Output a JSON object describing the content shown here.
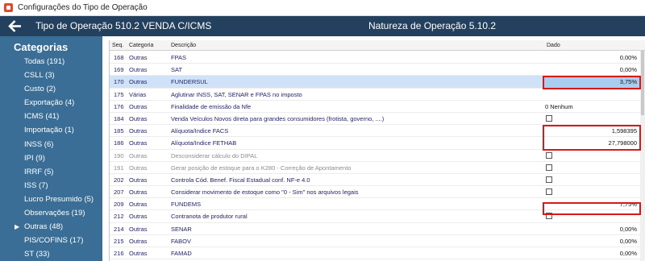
{
  "window": {
    "title": "Configurações do Tipo de Operação"
  },
  "header": {
    "operation_label": "Tipo de Operação 510.2   VENDA C/ICMS",
    "nature_label": "Natureza de Operação 5.10.2"
  },
  "sidebar": {
    "title": "Categorias",
    "items": [
      {
        "label": "Todas (191)"
      },
      {
        "label": "CSLL (3)"
      },
      {
        "label": "Custo (2)"
      },
      {
        "label": "Exportação (4)"
      },
      {
        "label": "ICMS (41)"
      },
      {
        "label": "Importação (1)"
      },
      {
        "label": "INSS (6)"
      },
      {
        "label": "IPI (9)"
      },
      {
        "label": "IRRF (5)"
      },
      {
        "label": "ISS (7)"
      },
      {
        "label": "Lucro Presumido (5)"
      },
      {
        "label": "Observações (19)"
      },
      {
        "label": "Outras (48)",
        "selected": true
      },
      {
        "label": "PIS/COFINS (17)"
      },
      {
        "label": "ST (33)"
      }
    ]
  },
  "grid": {
    "columns": {
      "seq": "Seq.",
      "categoria": "Categoria",
      "descricao": "Descrição",
      "dado": "Dado"
    },
    "rows": [
      {
        "seq": "168",
        "cat": "Outras",
        "desc": "FPAS",
        "type": "value",
        "value": "0,00%"
      },
      {
        "seq": "169",
        "cat": "Outras",
        "desc": "SAT",
        "type": "value",
        "value": "0,00%"
      },
      {
        "seq": "170",
        "cat": "Outras",
        "desc": "FUNDERSUL",
        "type": "value",
        "value": "3,75%",
        "selected": true
      },
      {
        "seq": "175",
        "cat": "Várias",
        "desc": "Aglutinar INSS, SAT, SENAR e FPAS no imposto",
        "type": "none"
      },
      {
        "seq": "176",
        "cat": "Outras",
        "desc": "Finalidade de emissão da Nfe",
        "type": "text",
        "value": "0  Nenhum"
      },
      {
        "seq": "184",
        "cat": "Outras",
        "desc": "Venda Veículos Novos direta para grandes consumidores (frotista, governo, ....)",
        "type": "check"
      },
      {
        "seq": "185",
        "cat": "Outras",
        "desc": "Alíquota/Indice FACS",
        "type": "value",
        "value": "1,598395"
      },
      {
        "seq": "186",
        "cat": "Outras",
        "desc": "Alíquota/Indice FETHAB",
        "type": "value",
        "value": "27,798000"
      },
      {
        "seq": "190",
        "cat": "Outras",
        "desc": "Desconsiderar cálculo do DIPAL",
        "type": "check",
        "disabled": true
      },
      {
        "seq": "191",
        "cat": "Outras",
        "desc": "Gerar posição de estoque para o K280 - Correção de Apontamento",
        "type": "check",
        "disabled": true
      },
      {
        "seq": "202",
        "cat": "Outras",
        "desc": "Controla Cód. Benef. Fiscal Estadual conf. NF-e 4.0",
        "type": "check"
      },
      {
        "seq": "207",
        "cat": "Outras",
        "desc": "Considerar movimento de estoque como \"0 - Sim\" nos arquivos legais",
        "type": "check"
      },
      {
        "seq": "209",
        "cat": "Outras",
        "desc": "FUNDEMS",
        "type": "value",
        "value": "7,75%"
      },
      {
        "seq": "212",
        "cat": "Outras",
        "desc": "Contranota de produtor rural",
        "type": "check"
      },
      {
        "seq": "214",
        "cat": "Outras",
        "desc": "SENAR",
        "type": "value",
        "value": "0,00%"
      },
      {
        "seq": "215",
        "cat": "Outras",
        "desc": "FABOV",
        "type": "value",
        "value": "0,00%"
      },
      {
        "seq": "216",
        "cat": "Outras",
        "desc": "FAMAD",
        "type": "value",
        "value": "0,00%"
      }
    ]
  },
  "colors": {
    "header_bg": "#24405f",
    "sidebar_bg": "#3a6e96",
    "selection_bg": "#cfe2f7",
    "highlight_border": "#d61a1a"
  }
}
